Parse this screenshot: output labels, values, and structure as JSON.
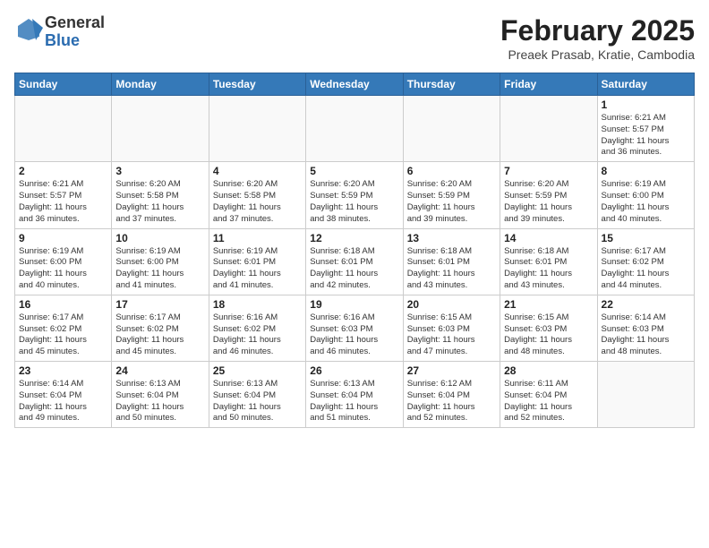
{
  "logo": {
    "general": "General",
    "blue": "Blue"
  },
  "title": "February 2025",
  "location": "Preaek Prasab, Kratie, Cambodia",
  "days_of_week": [
    "Sunday",
    "Monday",
    "Tuesday",
    "Wednesday",
    "Thursday",
    "Friday",
    "Saturday"
  ],
  "weeks": [
    [
      {
        "day": "",
        "info": ""
      },
      {
        "day": "",
        "info": ""
      },
      {
        "day": "",
        "info": ""
      },
      {
        "day": "",
        "info": ""
      },
      {
        "day": "",
        "info": ""
      },
      {
        "day": "",
        "info": ""
      },
      {
        "day": "1",
        "info": "Sunrise: 6:21 AM\nSunset: 5:57 PM\nDaylight: 11 hours\nand 36 minutes."
      }
    ],
    [
      {
        "day": "2",
        "info": "Sunrise: 6:21 AM\nSunset: 5:57 PM\nDaylight: 11 hours\nand 36 minutes."
      },
      {
        "day": "3",
        "info": "Sunrise: 6:20 AM\nSunset: 5:58 PM\nDaylight: 11 hours\nand 37 minutes."
      },
      {
        "day": "4",
        "info": "Sunrise: 6:20 AM\nSunset: 5:58 PM\nDaylight: 11 hours\nand 37 minutes."
      },
      {
        "day": "5",
        "info": "Sunrise: 6:20 AM\nSunset: 5:59 PM\nDaylight: 11 hours\nand 38 minutes."
      },
      {
        "day": "6",
        "info": "Sunrise: 6:20 AM\nSunset: 5:59 PM\nDaylight: 11 hours\nand 39 minutes."
      },
      {
        "day": "7",
        "info": "Sunrise: 6:20 AM\nSunset: 5:59 PM\nDaylight: 11 hours\nand 39 minutes."
      },
      {
        "day": "8",
        "info": "Sunrise: 6:19 AM\nSunset: 6:00 PM\nDaylight: 11 hours\nand 40 minutes."
      }
    ],
    [
      {
        "day": "9",
        "info": "Sunrise: 6:19 AM\nSunset: 6:00 PM\nDaylight: 11 hours\nand 40 minutes."
      },
      {
        "day": "10",
        "info": "Sunrise: 6:19 AM\nSunset: 6:00 PM\nDaylight: 11 hours\nand 41 minutes."
      },
      {
        "day": "11",
        "info": "Sunrise: 6:19 AM\nSunset: 6:01 PM\nDaylight: 11 hours\nand 41 minutes."
      },
      {
        "day": "12",
        "info": "Sunrise: 6:18 AM\nSunset: 6:01 PM\nDaylight: 11 hours\nand 42 minutes."
      },
      {
        "day": "13",
        "info": "Sunrise: 6:18 AM\nSunset: 6:01 PM\nDaylight: 11 hours\nand 43 minutes."
      },
      {
        "day": "14",
        "info": "Sunrise: 6:18 AM\nSunset: 6:01 PM\nDaylight: 11 hours\nand 43 minutes."
      },
      {
        "day": "15",
        "info": "Sunrise: 6:17 AM\nSunset: 6:02 PM\nDaylight: 11 hours\nand 44 minutes."
      }
    ],
    [
      {
        "day": "16",
        "info": "Sunrise: 6:17 AM\nSunset: 6:02 PM\nDaylight: 11 hours\nand 45 minutes."
      },
      {
        "day": "17",
        "info": "Sunrise: 6:17 AM\nSunset: 6:02 PM\nDaylight: 11 hours\nand 45 minutes."
      },
      {
        "day": "18",
        "info": "Sunrise: 6:16 AM\nSunset: 6:02 PM\nDaylight: 11 hours\nand 46 minutes."
      },
      {
        "day": "19",
        "info": "Sunrise: 6:16 AM\nSunset: 6:03 PM\nDaylight: 11 hours\nand 46 minutes."
      },
      {
        "day": "20",
        "info": "Sunrise: 6:15 AM\nSunset: 6:03 PM\nDaylight: 11 hours\nand 47 minutes."
      },
      {
        "day": "21",
        "info": "Sunrise: 6:15 AM\nSunset: 6:03 PM\nDaylight: 11 hours\nand 48 minutes."
      },
      {
        "day": "22",
        "info": "Sunrise: 6:14 AM\nSunset: 6:03 PM\nDaylight: 11 hours\nand 48 minutes."
      }
    ],
    [
      {
        "day": "23",
        "info": "Sunrise: 6:14 AM\nSunset: 6:04 PM\nDaylight: 11 hours\nand 49 minutes."
      },
      {
        "day": "24",
        "info": "Sunrise: 6:13 AM\nSunset: 6:04 PM\nDaylight: 11 hours\nand 50 minutes."
      },
      {
        "day": "25",
        "info": "Sunrise: 6:13 AM\nSunset: 6:04 PM\nDaylight: 11 hours\nand 50 minutes."
      },
      {
        "day": "26",
        "info": "Sunrise: 6:13 AM\nSunset: 6:04 PM\nDaylight: 11 hours\nand 51 minutes."
      },
      {
        "day": "27",
        "info": "Sunrise: 6:12 AM\nSunset: 6:04 PM\nDaylight: 11 hours\nand 52 minutes."
      },
      {
        "day": "28",
        "info": "Sunrise: 6:11 AM\nSunset: 6:04 PM\nDaylight: 11 hours\nand 52 minutes."
      },
      {
        "day": "",
        "info": ""
      }
    ]
  ]
}
